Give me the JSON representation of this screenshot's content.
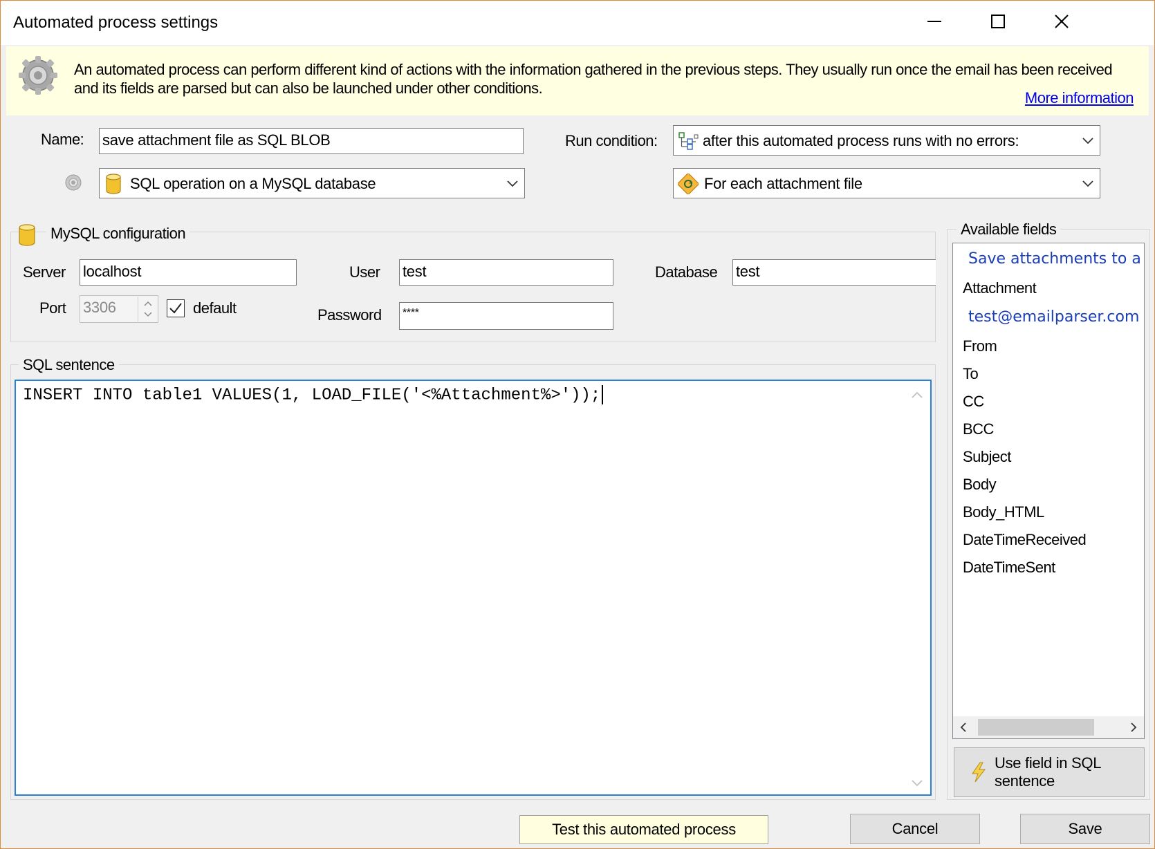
{
  "window": {
    "title": "Automated process settings"
  },
  "banner": {
    "text_line1": "An automated process can perform different kind of actions with the information gathered in the previous steps. They usually run once the email has been received",
    "text_line2": "and its fields are parsed but can also be launched under other conditions.",
    "more_info_link": "More information"
  },
  "form": {
    "name_label": "Name:",
    "name_value": "save attachment file as SQL BLOB",
    "action_type": "SQL operation on a MySQL database",
    "run_condition_label": "Run condition:",
    "run_condition_value": "after this automated process runs with no errors:",
    "iteration_value": "For each attachment file"
  },
  "mysql": {
    "group_title": "MySQL configuration",
    "server_label": "Server",
    "server_value": "localhost",
    "user_label": "User",
    "user_value": "test",
    "database_label": "Database",
    "database_value": "test",
    "port_label": "Port",
    "port_value": "3306",
    "default_label": "default",
    "default_checked": true,
    "password_label": "Password",
    "password_value": "****"
  },
  "sql": {
    "group_title": "SQL sentence",
    "sentence": "INSERT INTO table1 VALUES(1, LOAD_FILE('<%Attachment%>'));"
  },
  "available_fields": {
    "title": "Available fields",
    "groups": [
      {
        "header": "Save attachments to a fo",
        "items": [
          "Attachment"
        ]
      },
      {
        "header": "test@emailparser.com -",
        "items": [
          "From",
          "To",
          "CC",
          "BCC",
          "Subject",
          "Body",
          "Body_HTML",
          "DateTimeReceived",
          "DateTimeSent"
        ]
      }
    ],
    "use_field_button_line1": "Use field in SQL",
    "use_field_button_line2": "sentence"
  },
  "buttons": {
    "test": "Test this automated process",
    "cancel": "Cancel",
    "save": "Save"
  },
  "colors": {
    "accent_border": "#e08a3c",
    "banner_bg": "#ffffe1",
    "link": "#0000ee",
    "focus_border": "#2a7fd4",
    "field_group_text": "#1a3db8",
    "test_button_bg": "#ffffdf"
  }
}
